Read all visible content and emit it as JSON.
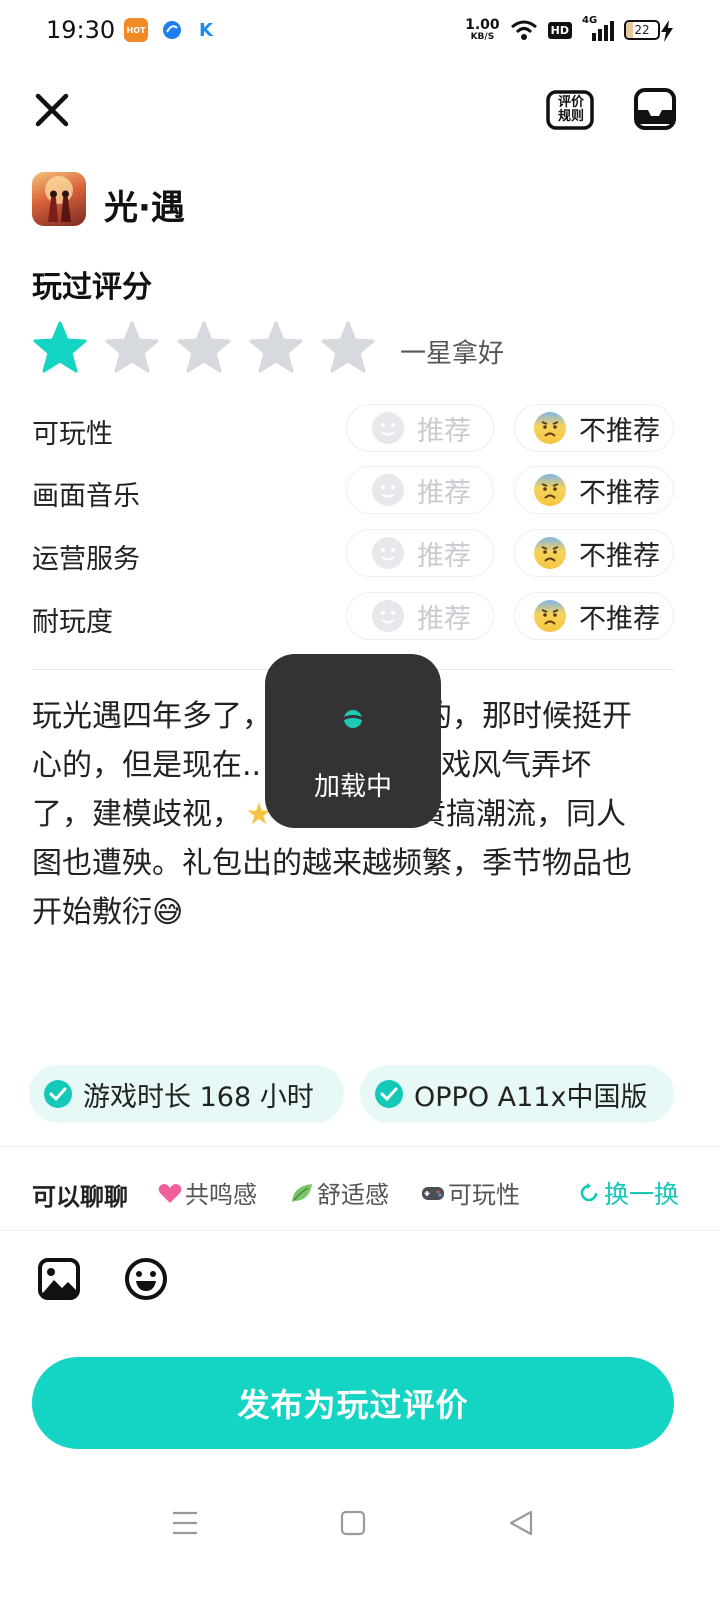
{
  "status_bar": {
    "time": "19:30",
    "net_speed_value": "1.00",
    "net_speed_unit": "KB/S",
    "hd": "HD",
    "network": "4G",
    "battery": "22",
    "battery_level_percent": 22,
    "app_icons": [
      "HOT",
      "K"
    ]
  },
  "header": {
    "close_icon": "close-icon",
    "rules_label_line1": "评价",
    "rules_label_line2": "规则",
    "inbox_icon": "inbox-icon"
  },
  "game": {
    "name": "光·遇"
  },
  "rating": {
    "section_title": "玩过评分",
    "stars_filled": 1,
    "stars_total": 5,
    "active_color": "#14d4c3",
    "inactive_color": "#d6d9dd",
    "rating_text": "一星拿好"
  },
  "aspects": [
    {
      "label": "可玩性",
      "recommend": "推荐",
      "not_recommend": "不推荐",
      "selected": "not_recommend"
    },
    {
      "label": "画面音乐",
      "recommend": "推荐",
      "not_recommend": "不推荐",
      "selected": "not_recommend"
    },
    {
      "label": "运营服务",
      "recommend": "推荐",
      "not_recommend": "不推荐",
      "selected": "not_recommend"
    },
    {
      "label": "耐玩度",
      "recommend": "推荐",
      "not_recommend": "不推荐",
      "selected": "not_recommend"
    }
  ],
  "review": {
    "line1": "玩光遇四年多了，",
    "line1b": "的，那时候挺开",
    "line2": "心的，但是现在..",
    "line2b": "游戏风气弄坏",
    "line3": "了，建模歧视，",
    "line3b": "把黄搞潮流，同人",
    "line4": "图也遭殃。礼包出的越来越频繁，季节物品也",
    "line5": "开始敷衍😅"
  },
  "loading": {
    "text": "加载中"
  },
  "tags": [
    {
      "text": "游戏时长 168 小时"
    },
    {
      "text": "OPPO A11x中国版"
    }
  ],
  "chat": {
    "label": "可以聊聊",
    "topics": [
      "共鸣感",
      "舒适感",
      "可玩性"
    ],
    "refresh": "换一换"
  },
  "toolbar": {
    "image_icon": "image-icon",
    "emoji_icon": "emoji-icon"
  },
  "publish": {
    "label": "发布为玩过评价",
    "color": "#14d4c3"
  },
  "nav": {
    "icons": [
      "menu-icon",
      "home-icon",
      "back-icon"
    ]
  }
}
